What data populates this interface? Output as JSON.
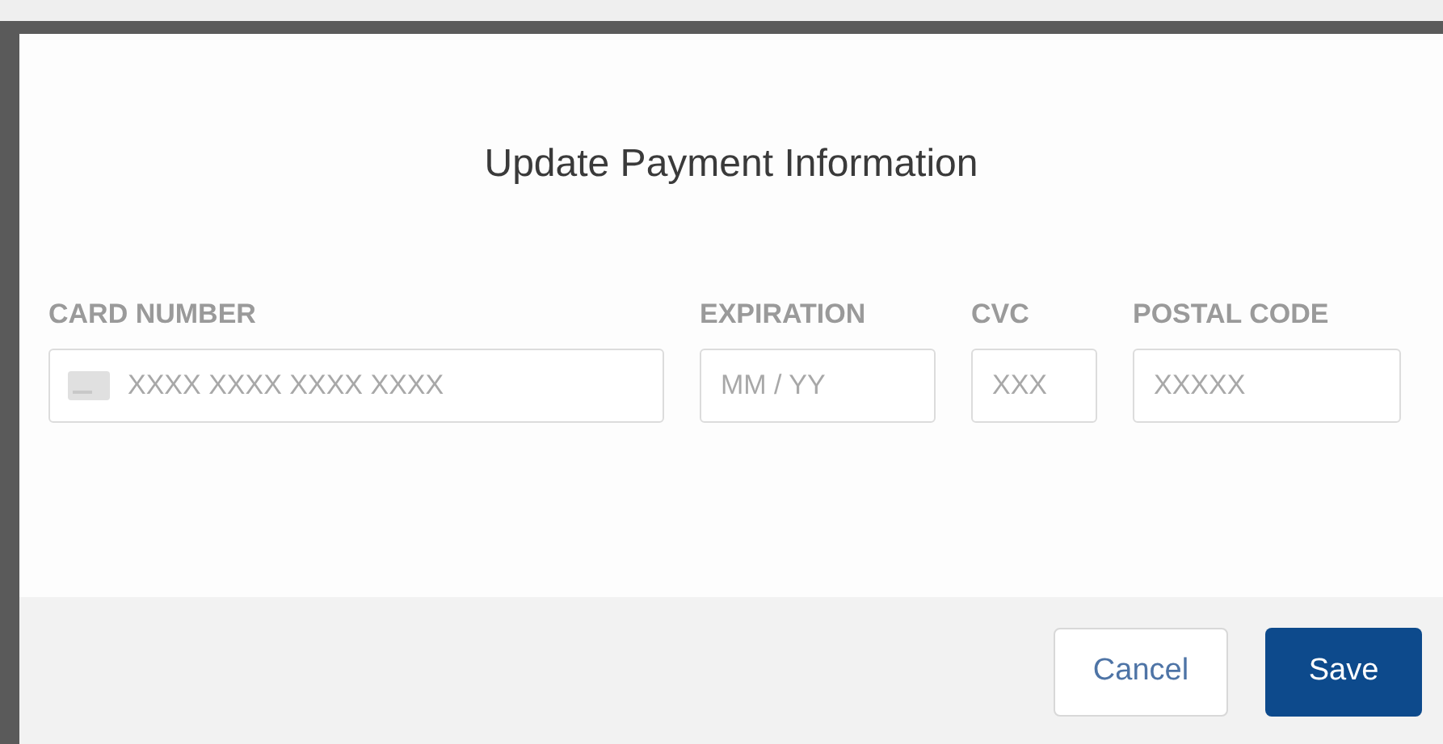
{
  "dialog": {
    "title": "Update Payment Information",
    "fields": [
      {
        "kind": "card",
        "label": "CARD NUMBER",
        "placeholder": "XXXX XXXX XXXX XXXX"
      },
      {
        "kind": "plain",
        "label": "EXPIRATION",
        "placeholder": "MM / YY"
      },
      {
        "kind": "plain",
        "label": "CVC",
        "placeholder": "XXX"
      },
      {
        "kind": "plain",
        "label": "POSTAL CODE",
        "placeholder": "XXXXX"
      }
    ],
    "buttons": [
      {
        "kind": "secondary",
        "label": "Cancel"
      },
      {
        "kind": "primary",
        "label": "Save"
      }
    ]
  }
}
